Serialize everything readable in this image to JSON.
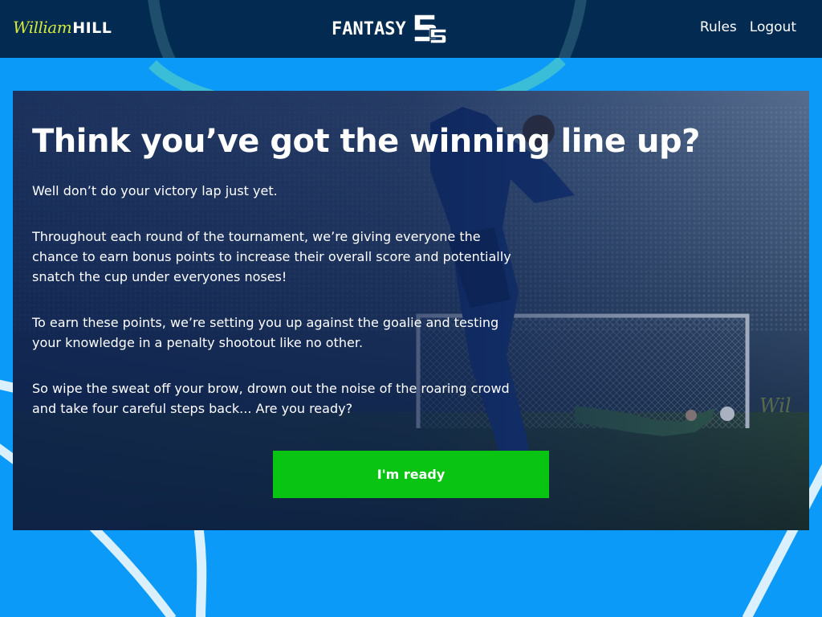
{
  "header": {
    "brand_script": "William",
    "brand_bold": "HILL",
    "app_logo_text": "FANTASY",
    "app_logo_number": "5s",
    "nav": [
      {
        "label": "Rules"
      },
      {
        "label": "Logout"
      }
    ]
  },
  "hero": {
    "title": "Think you’ve got the winning line up?",
    "paragraphs": [
      "Well don’t do your victory lap just yet.",
      "Throughout each round of the tournament, we’re giving everyone the chance to earn bonus points to increase their overall score and potentially snatch the cup under everyones noses!",
      "To earn these points, we’re setting you up against the goalie and testing your knowledge in a penalty shootout like no other.",
      "So wipe the sweat off your brow, drown out the noise of the roaring crowd and take four careful steps back... Are you ready?"
    ],
    "cta_label": "I'm ready"
  },
  "colors": {
    "page_background": "#0b9af7",
    "header_background": "#032b52",
    "cta_background": "#09c412",
    "brand_yellow": "#d5e83a"
  },
  "icons": {
    "brand_logo": "william-hill-logo",
    "app_logo": "fantasy-5s-logo"
  }
}
